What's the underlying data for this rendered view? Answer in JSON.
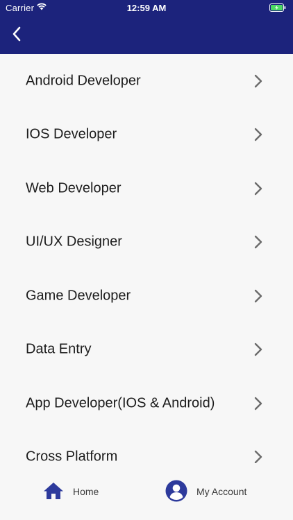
{
  "status_bar": {
    "carrier": "Carrier",
    "time": "12:59 AM",
    "wifi_icon": "wifi-icon",
    "battery_icon": "battery-charging-icon"
  },
  "header": {
    "back_icon": "chevron-left-icon",
    "background_color": "#1c237c"
  },
  "list": {
    "items": [
      {
        "label": "Android Developer"
      },
      {
        "label": "IOS Developer"
      },
      {
        "label": "Web Developer"
      },
      {
        "label": "UI/UX Designer"
      },
      {
        "label": "Game Developer"
      },
      {
        "label": "Data Entry"
      },
      {
        "label": "App Developer(IOS & Android)"
      },
      {
        "label": "Cross Platform"
      }
    ],
    "chevron_icon": "chevron-right-icon"
  },
  "bottom_nav": {
    "home": {
      "label": "Home",
      "icon": "home-icon"
    },
    "account": {
      "label": "My Account",
      "icon": "account-icon"
    },
    "accent_color": "#2d3a9c"
  }
}
